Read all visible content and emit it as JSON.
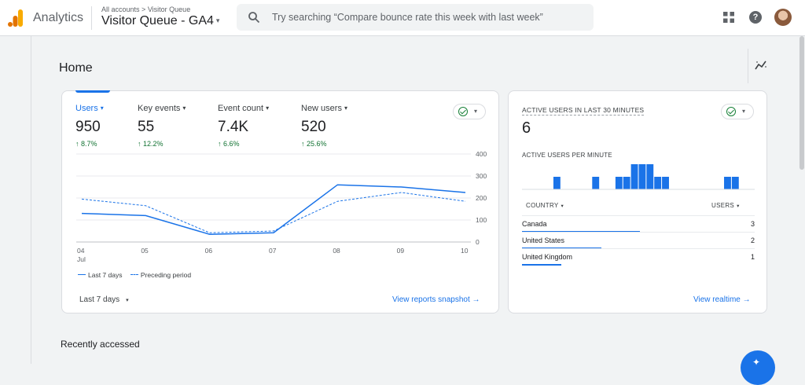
{
  "app": {
    "name": "Analytics"
  },
  "breadcrumb": {
    "root": "All accounts",
    "separator": ">",
    "account": "Visitor Queue"
  },
  "property": {
    "name": "Visitor Queue - GA4",
    "caret": "▾"
  },
  "search": {
    "placeholder": "Try searching “Compare bounce rate this week with last week”"
  },
  "page": {
    "title": "Home"
  },
  "metrics": [
    {
      "label": "Users",
      "value": "950",
      "change": "8.7%",
      "arrow": "↑",
      "dd": "▾"
    },
    {
      "label": "Key events",
      "value": "55",
      "change": "12.2%",
      "arrow": "↑",
      "dd": "▾"
    },
    {
      "label": "Event count",
      "value": "7.4K",
      "change": "6.6%",
      "arrow": "↑",
      "dd": "▾"
    },
    {
      "label": "New users",
      "value": "520",
      "change": "25.6%",
      "arrow": "↑",
      "dd": "▾"
    }
  ],
  "chart_data": {
    "type": "line",
    "x": [
      "04",
      "05",
      "06",
      "07",
      "08",
      "09",
      "10"
    ],
    "x_sub": "Jul",
    "yticks": [
      0,
      100,
      200,
      300,
      400
    ],
    "ylim": [
      0,
      400
    ],
    "series": [
      {
        "name": "Last 7 days",
        "style": "solid",
        "values": [
          130,
          120,
          35,
          42,
          260,
          250,
          225
        ]
      },
      {
        "name": "Preceding period",
        "style": "dashed",
        "values": [
          195,
          165,
          42,
          50,
          185,
          225,
          185
        ]
      }
    ],
    "grid": true,
    "legend": "bottom-left",
    "color": "#1a73e8"
  },
  "date_range": {
    "label": "Last 7 days",
    "dd": "▾"
  },
  "links": {
    "reports_snapshot": "View reports snapshot",
    "realtime": "View realtime",
    "arrow": "→"
  },
  "realtime": {
    "title": "ACTIVE USERS IN LAST 30 MINUTES",
    "value": "6",
    "per_minute_label": "ACTIVE USERS PER MINUTE",
    "per_minute": [
      0,
      0,
      0,
      0,
      1,
      0,
      0,
      0,
      0,
      1,
      0,
      0,
      1,
      1,
      2,
      2,
      2,
      1,
      1,
      0,
      0,
      0,
      0,
      0,
      0,
      0,
      1,
      1,
      0,
      0
    ],
    "col_country": "COUNTRY",
    "col_users": "USERS",
    "dd": "▾",
    "rows": [
      {
        "country": "Canada",
        "users": "3",
        "share": 1.0
      },
      {
        "country": "United States",
        "users": "2",
        "share": 0.67
      },
      {
        "country": "United Kingdom",
        "users": "1",
        "share": 0.33
      }
    ]
  },
  "sections": {
    "recent": "Recently accessed"
  },
  "colors": {
    "accent": "#1a73e8",
    "positive": "#137333",
    "logo_orange": "#f9ab00",
    "logo_dark": "#e37400"
  }
}
